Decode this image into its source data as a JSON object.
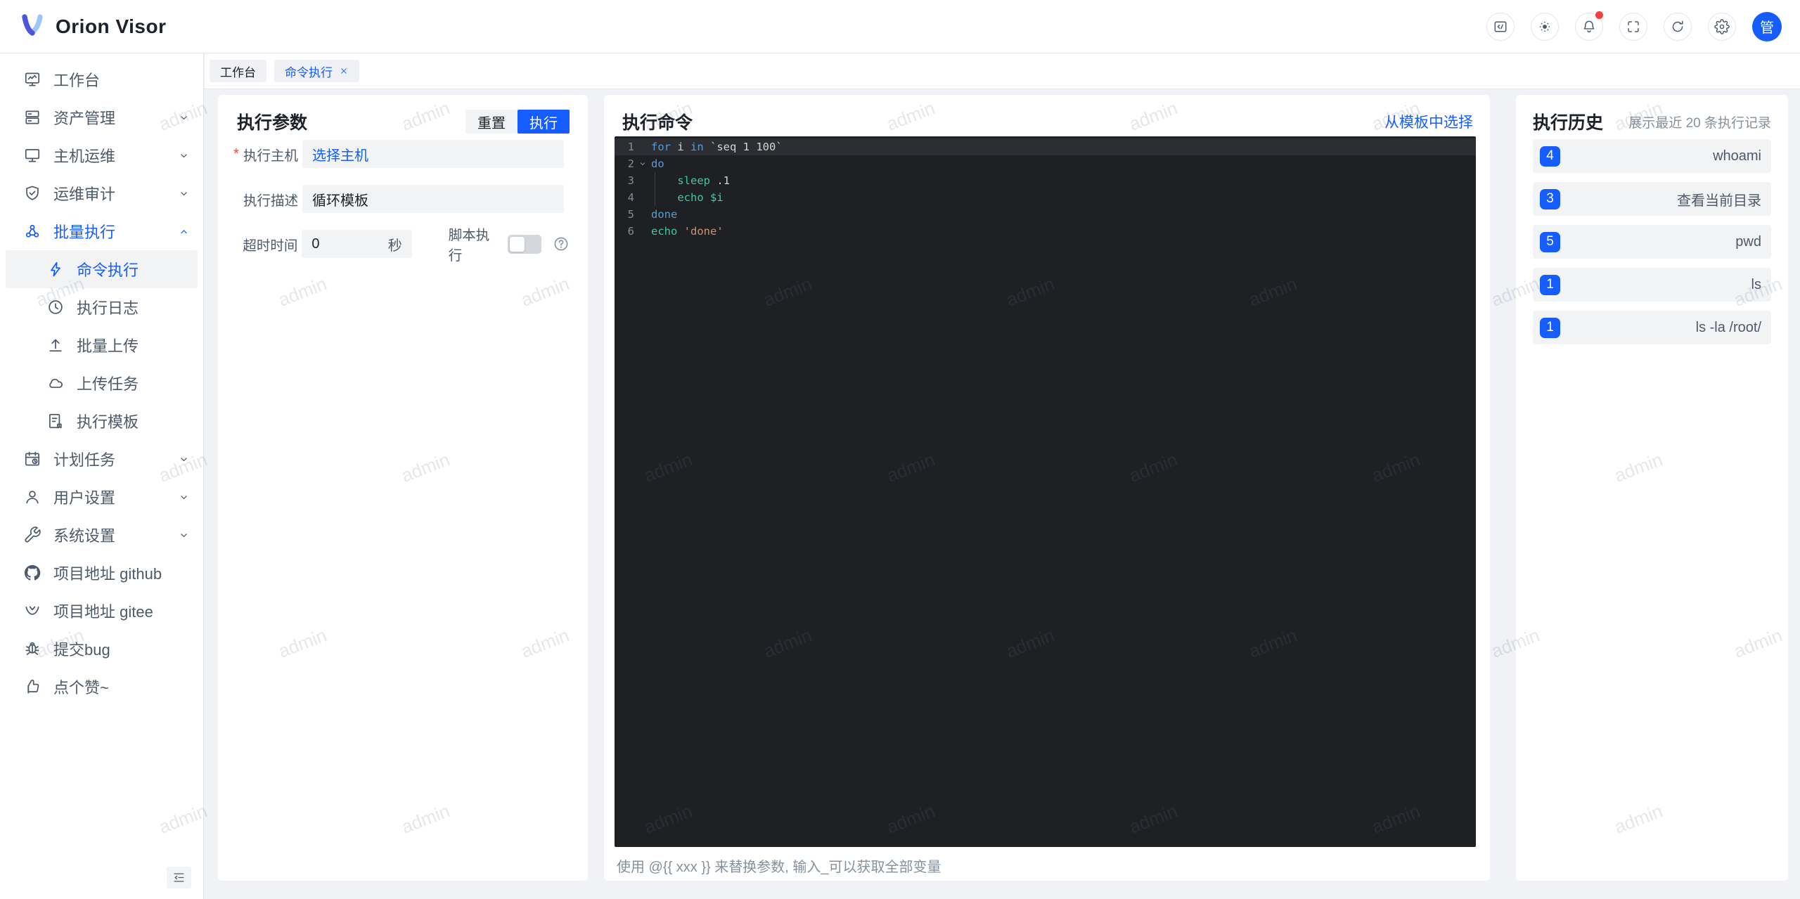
{
  "app": {
    "title": "Orion Visor"
  },
  "topbar": {
    "avatar": "管",
    "buttons": [
      {
        "name": "code-icon"
      },
      {
        "name": "brightness-icon"
      },
      {
        "name": "bell-icon",
        "badge": true
      },
      {
        "name": "fullscreen-icon"
      },
      {
        "name": "refresh-icon"
      },
      {
        "name": "settings-icon"
      }
    ]
  },
  "tabs": [
    {
      "id": "workbench",
      "label": "工作台",
      "active": false,
      "closable": false
    },
    {
      "id": "command-exec",
      "label": "命令执行",
      "active": true,
      "closable": true
    }
  ],
  "sidebar": {
    "items": [
      {
        "id": "workbench",
        "label": "工作台",
        "icon": "dashboard-icon",
        "level": 1
      },
      {
        "id": "asset-mgmt",
        "label": "资产管理",
        "icon": "assets-icon",
        "level": 1,
        "chevron": "down"
      },
      {
        "id": "host-ops",
        "label": "主机运维",
        "icon": "host-ops-icon",
        "level": 1,
        "chevron": "down"
      },
      {
        "id": "ops-audit",
        "label": "运维审计",
        "icon": "audit-icon",
        "level": 1,
        "chevron": "down"
      },
      {
        "id": "batch-exec",
        "label": "批量执行",
        "icon": "batch-exec-icon",
        "level": 1,
        "chevron": "up",
        "highlight": true
      },
      {
        "id": "command-exec",
        "label": "命令执行",
        "icon": "command-exec-icon",
        "level": 2,
        "active": true
      },
      {
        "id": "exec-log",
        "label": "执行日志",
        "icon": "exec-log-icon",
        "level": 2
      },
      {
        "id": "batch-upload",
        "label": "批量上传",
        "icon": "batch-upload-icon",
        "level": 2
      },
      {
        "id": "upload-task",
        "label": "上传任务",
        "icon": "upload-task-icon",
        "level": 2
      },
      {
        "id": "exec-template",
        "label": "执行模板",
        "icon": "exec-template-icon",
        "level": 2
      },
      {
        "id": "schedule-task",
        "label": "计划任务",
        "icon": "schedule-icon",
        "level": 1,
        "chevron": "down"
      },
      {
        "id": "user-settings",
        "label": "用户设置",
        "icon": "user-settings-icon",
        "level": 1,
        "chevron": "down"
      },
      {
        "id": "system-settings",
        "label": "系统设置",
        "icon": "system-settings-icon",
        "level": 1,
        "chevron": "down"
      },
      {
        "id": "github",
        "label": "项目地址 github",
        "icon": "github-icon",
        "level": 1
      },
      {
        "id": "gitee",
        "label": "项目地址 gitee",
        "icon": "gitee-icon",
        "level": 1
      },
      {
        "id": "bug-report",
        "label": "提交bug",
        "icon": "bug-icon",
        "level": 1
      },
      {
        "id": "like",
        "label": "点个赞~",
        "icon": "like-icon",
        "level": 1
      }
    ]
  },
  "params_panel": {
    "title": "执行参数",
    "reset_label": "重置",
    "run_label": "执行",
    "host": {
      "label": "执行主机",
      "required": true,
      "value": "选择主机"
    },
    "desc": {
      "label": "执行描述",
      "value": "循环模板"
    },
    "timeout": {
      "label": "超时时间",
      "value": "0",
      "unit": "秒"
    },
    "script": {
      "label": "脚本执行",
      "enabled": false
    }
  },
  "command_panel": {
    "title": "执行命令",
    "template_link": "从模板中选择",
    "hint": "使用 @{{ xxx }} 来替换参数, 输入_可以获取全部变量",
    "lines": [
      {
        "num": "1",
        "current": true,
        "tokens": [
          [
            "for",
            "kw"
          ],
          [
            " i ",
            "pl"
          ],
          [
            "in",
            "kw"
          ],
          [
            " `seq 1 100`",
            "pl"
          ]
        ]
      },
      {
        "num": "2",
        "fold": true,
        "tokens": [
          [
            "do",
            "kw"
          ]
        ]
      },
      {
        "num": "3",
        "guide": true,
        "tokens": [
          [
            "    ",
            "pl"
          ],
          [
            "sleep",
            "cmd"
          ],
          [
            " .1",
            "pl"
          ]
        ]
      },
      {
        "num": "4",
        "guide": true,
        "tokens": [
          [
            "    ",
            "pl"
          ],
          [
            "echo",
            "cmd"
          ],
          [
            " ",
            "pl"
          ],
          [
            "$i",
            "var"
          ]
        ]
      },
      {
        "num": "5",
        "tokens": [
          [
            "done",
            "kw"
          ]
        ]
      },
      {
        "num": "6",
        "tokens": [
          [
            "echo",
            "cmd"
          ],
          [
            " ",
            "pl"
          ],
          [
            "'done'",
            "str"
          ]
        ]
      }
    ]
  },
  "history_panel": {
    "title": "执行历史",
    "subtitle": "展示最近 20 条执行记录",
    "items": [
      {
        "count": "4",
        "command": "whoami"
      },
      {
        "count": "3",
        "command": "查看当前目录"
      },
      {
        "count": "5",
        "command": "pwd"
      },
      {
        "count": "1",
        "command": "ls"
      },
      {
        "count": "1",
        "command": "ls -la /root/"
      }
    ]
  },
  "watermark": {
    "text": "admin"
  },
  "colors": {
    "accent": "#165dff",
    "danger": "#f53f3f",
    "border": "#e5e6eb",
    "editor_bg": "#1e2023",
    "keyword": "#569cd6",
    "command": "#3ec9a0",
    "string": "#ce9178",
    "variable": "#4ec9b0",
    "plain": "#d4d4d4"
  }
}
